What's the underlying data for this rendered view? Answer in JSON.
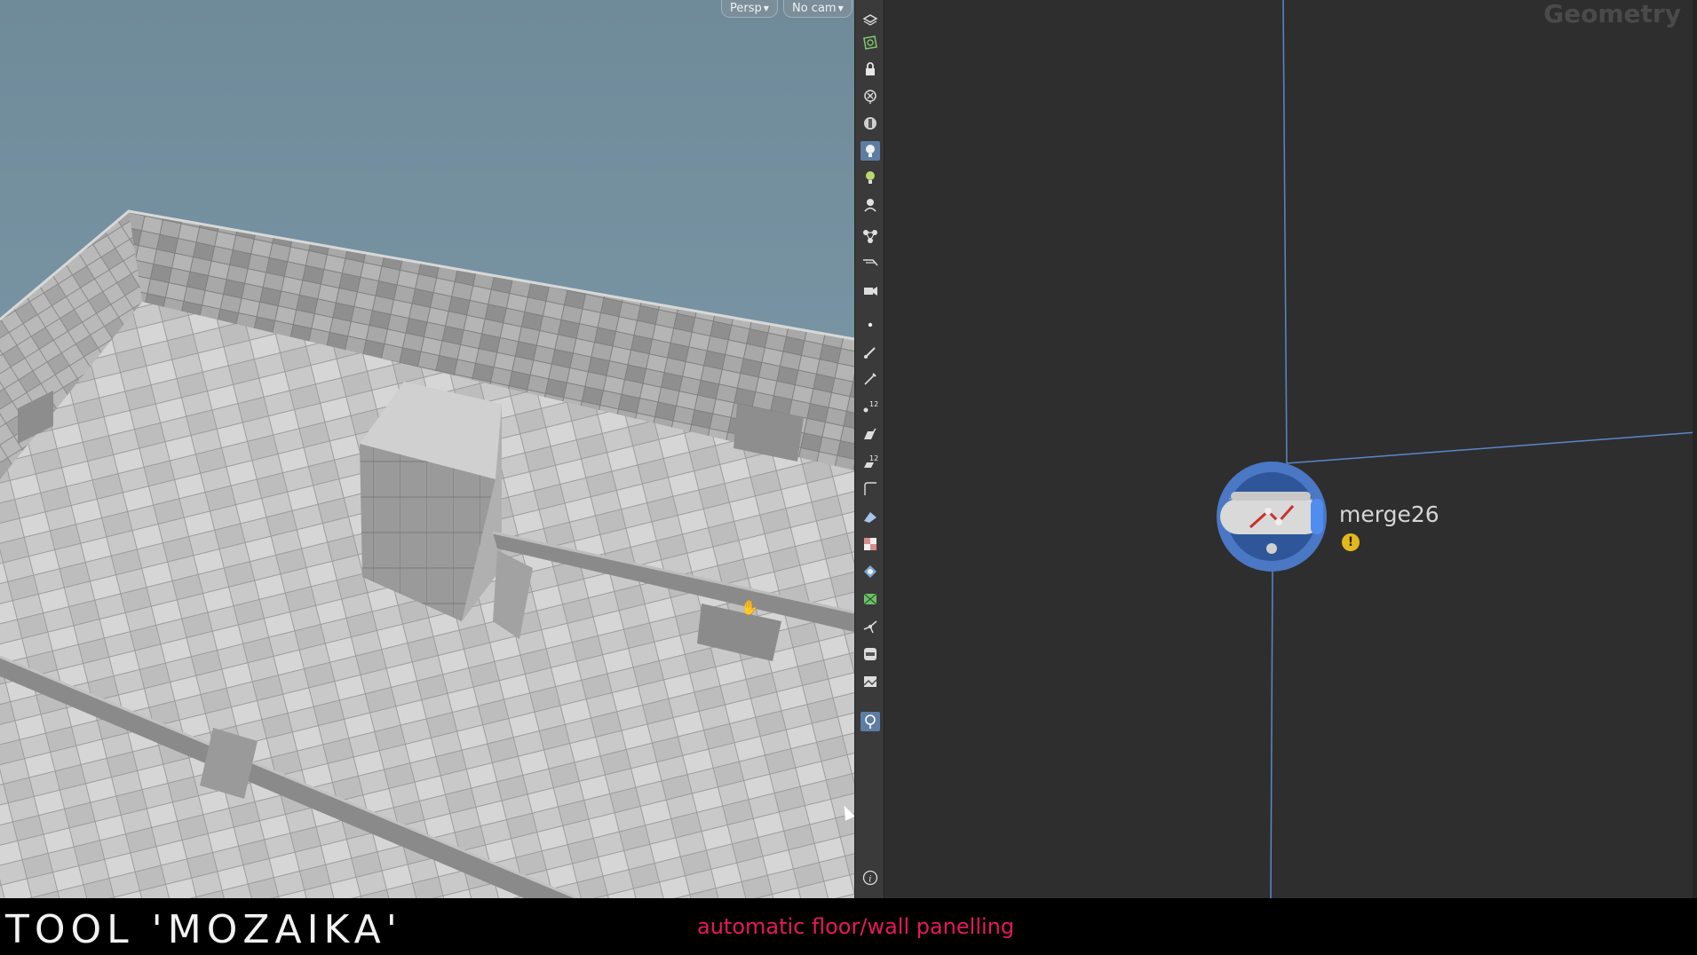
{
  "viewport": {
    "view_button": "Persp",
    "camera_button": "No cam",
    "scene_description_icon": "tiled-floor-scene"
  },
  "toolbar": {
    "icons": [
      "display-options-icon",
      "select-geometry-icon",
      "lock-icon",
      "ghost-icon",
      "shading-icon",
      "light-bulb-icon",
      "point-light-icon",
      "spot-light-icon",
      "connectivity-icon",
      "camera-display-icon",
      "camera-options-icon",
      "point-dot-icon",
      "brush-icon",
      "pen-icon",
      "point-numbers-icon",
      "normals-icon",
      "prim-numbers-icon",
      "curve-icon",
      "uv-icon",
      "texture-checker-icon",
      "background-icon",
      "map-icon",
      "snap-icon",
      "background-image-icon",
      "environment-icon",
      "pin-icon",
      "info-icon"
    ]
  },
  "network": {
    "context_label": "Geometry",
    "node_name": "merge26",
    "node_warning": "!"
  },
  "caption": {
    "title": "TOOL 'MOZAIKA'",
    "subtitle": "automatic floor/wall panelling"
  },
  "colors": {
    "sky": "#6d8796",
    "network_bg": "#2e2e2e",
    "node_ring": "#4a78c4",
    "wire": "#5b86c9",
    "subtitle": "#e8175d",
    "warning": "#e3b81d"
  }
}
